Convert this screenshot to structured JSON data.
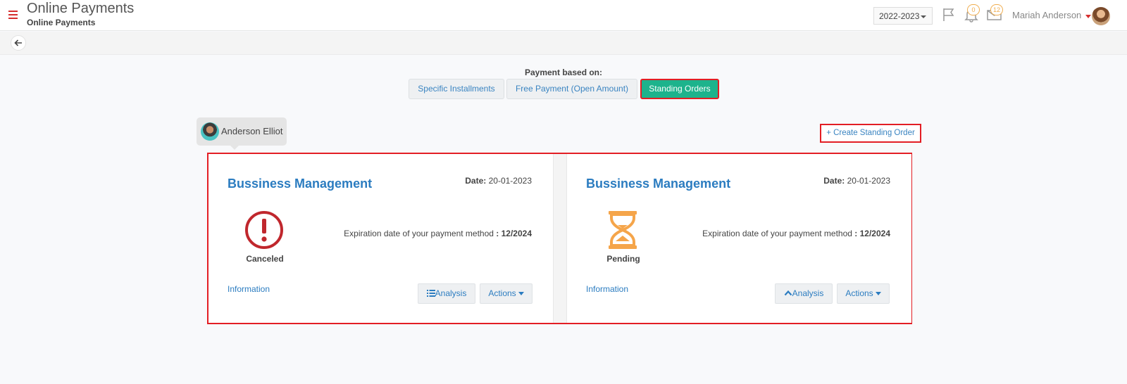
{
  "header": {
    "title": "Online Payments",
    "subtitle": "Online Payments",
    "year": "2022-2023",
    "notifications_count": "0",
    "messages_count": "12",
    "user_name": "Mariah Anderson"
  },
  "payment": {
    "label": "Payment based on:",
    "options": [
      {
        "label": "Specific Installments",
        "active": false
      },
      {
        "label": "Free Payment (Open Amount)",
        "active": false
      },
      {
        "label": "Standing Orders",
        "active": true
      }
    ]
  },
  "student": {
    "name": "Anderson Elliot"
  },
  "create_button": "+ Create Standing Order",
  "colors": {
    "accent": "#1db38c",
    "highlight": "#e31e24",
    "link": "#2b7cc0",
    "canceled": "#c0272d",
    "pending": "#f5a54a"
  },
  "orders": [
    {
      "title": "Bussiness Management",
      "date_label": "Date:",
      "date": "20-01-2023",
      "status": "Canceled",
      "status_icon": "exclamation-circle-icon",
      "expiry_label": "Expiration date of your payment method",
      "expiry_value": ": 12/2024",
      "info_link": "Information",
      "analysis": "Analysis",
      "actions": "Actions"
    },
    {
      "title": "Bussiness Management",
      "date_label": "Date:",
      "date": "20-01-2023",
      "status": "Pending",
      "status_icon": "hourglass-icon",
      "expiry_label": "Expiration date of your payment method",
      "expiry_value": ": 12/2024",
      "info_link": "Information",
      "analysis": "Analysis",
      "actions": "Actions"
    }
  ]
}
